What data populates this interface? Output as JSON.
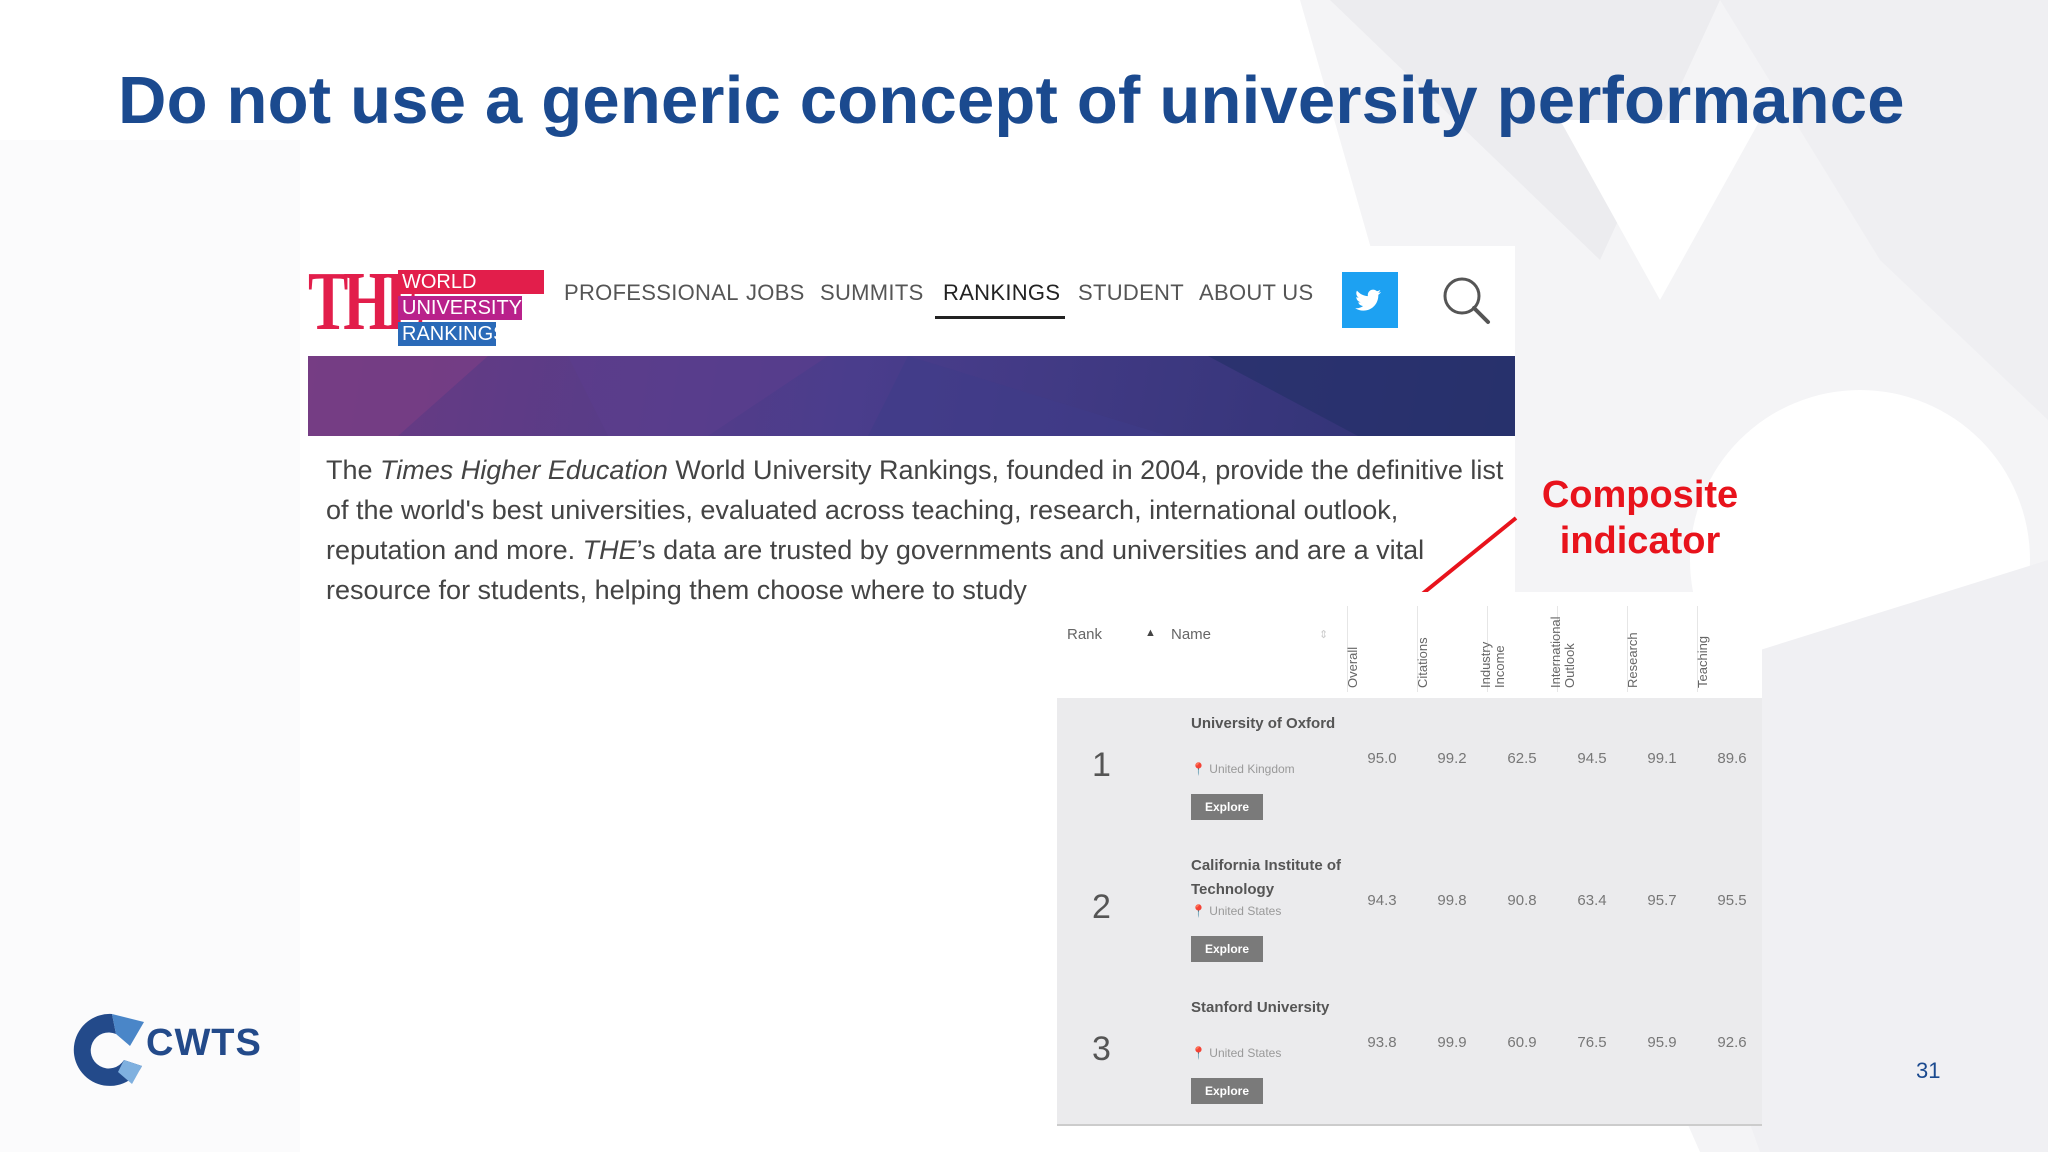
{
  "slide": {
    "title": "Do not use a generic concept of university performance",
    "page_number": "31",
    "annotation": {
      "line1": "Composite",
      "line2": "indicator"
    },
    "footer_logo_text": "CWTS"
  },
  "website": {
    "logo": {
      "letters": "THE",
      "line1": "WORLD",
      "line2": "UNIVERSITY",
      "line3": "RANKINGS"
    },
    "nav": [
      "PROFESSIONAL",
      "JOBS",
      "SUMMITS",
      "RANKINGS",
      "STUDENT",
      "ABOUT US"
    ],
    "active_nav": "RANKINGS",
    "intro": {
      "l1_a": "The ",
      "l1_i": "Times Higher Education",
      "l1_b": " World University Rankings, founded in 2004, provide the definitive list",
      "l2": "of the world's best universities, evaluated across teaching, research, international outlook,",
      "l3_a": "reputation and more. ",
      "l3_i": "THE",
      "l3_b": "’s data are trusted by governments and universities and are a vital",
      "l4": "resource for students, helping them choose where to study"
    },
    "table": {
      "headers": {
        "rank": "Rank",
        "name": "Name",
        "overall": "Overall",
        "citations": "Citations",
        "industry_income": "Industry Income",
        "international_outlook": "International Outlook",
        "research": "Research",
        "teaching": "Teaching"
      },
      "explore_label": "Explore",
      "rows": [
        {
          "rank": "1",
          "name": "University of Oxford",
          "country": "United Kingdom",
          "overall": "95.0",
          "citations": "99.2",
          "industry_income": "62.5",
          "international_outlook": "94.5",
          "research": "99.1",
          "teaching": "89.6"
        },
        {
          "rank": "2",
          "name": "California Institute of Technology",
          "country": "United States",
          "overall": "94.3",
          "citations": "99.8",
          "industry_income": "90.8",
          "international_outlook": "63.4",
          "research": "95.7",
          "teaching": "95.5"
        },
        {
          "rank": "3",
          "name": "Stanford University",
          "country": "United States",
          "overall": "93.8",
          "citations": "99.9",
          "industry_income": "60.9",
          "international_outlook": "76.5",
          "research": "95.9",
          "teaching": "92.6"
        }
      ]
    }
  },
  "colors": {
    "title_blue": "#1b4a8f",
    "annotation_red": "#e8131c",
    "the_red": "#e21e4b",
    "twitter_blue": "#1da1f2"
  },
  "icons": [
    "twitter-icon",
    "search-icon",
    "location-pin-icon",
    "sort-icon"
  ]
}
